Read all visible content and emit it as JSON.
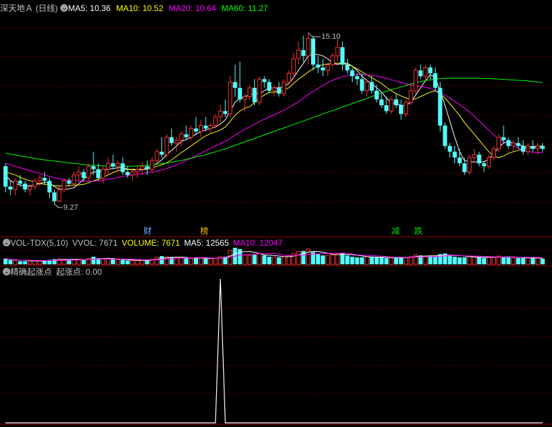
{
  "price_panel": {
    "title": "深天地Ａ (日线)",
    "ma_labels": [
      {
        "text": "MA5: 10.36",
        "color": "#ffffff"
      },
      {
        "text": "MA10: 10.52",
        "color": "#ffff00"
      },
      {
        "text": "MA20: 10.64",
        "color": "#ff00ff"
      },
      {
        "text": "MA60: 11.27",
        "color": "#00ff00"
      }
    ],
    "high_marker": "15.10",
    "low_marker": "9.27",
    "events": [
      {
        "text": "财",
        "color": "#6fa8ff"
      },
      {
        "text": "榜",
        "color": "#ffbf00"
      },
      {
        "text": "减",
        "color": "#00dd00"
      },
      {
        "text": "跌",
        "color": "#00dd00"
      }
    ]
  },
  "volume_panel": {
    "items": [
      {
        "text": "VOL-TDX(5,10)",
        "color": "#c0c0c0"
      },
      {
        "text": "VVOL: 7671",
        "color": "#c0c0c0"
      },
      {
        "text": "VOLUME: 7671",
        "color": "#ffff00"
      },
      {
        "text": "MA5: 12565",
        "color": "#ffffff"
      },
      {
        "text": "MA10: 12047",
        "color": "#ff00ff"
      }
    ]
  },
  "indicator_panel": {
    "title": "精确起涨点",
    "value_label": "起涨点: 0.00"
  },
  "colors": {
    "up": "#ff3232",
    "down": "#54ffff",
    "grid": "#9a0000",
    "ma5": "#ffffff",
    "ma10": "#ffff00",
    "ma20": "#ff00ff",
    "ma60": "#00ff00"
  },
  "chart_data": {
    "type": "candlestick",
    "price_range": [
      8.6,
      15.7
    ],
    "candles": [
      [
        10.5,
        10.6,
        9.6,
        9.8
      ],
      [
        9.8,
        10.0,
        9.5,
        9.7
      ],
      [
        9.7,
        10.1,
        9.5,
        10.0
      ],
      [
        10.0,
        10.2,
        9.8,
        9.9
      ],
      [
        9.9,
        10.0,
        9.6,
        9.7
      ],
      [
        9.7,
        9.9,
        9.5,
        9.8
      ],
      [
        9.8,
        10.1,
        9.7,
        10.0
      ],
      [
        10.0,
        10.2,
        9.8,
        10.1
      ],
      [
        10.1,
        10.3,
        9.9,
        10.0
      ],
      [
        10.0,
        10.1,
        9.4,
        9.6
      ],
      [
        9.6,
        9.7,
        9.2,
        9.3
      ],
      [
        9.3,
        9.8,
        9.27,
        9.7
      ],
      [
        9.7,
        10.1,
        9.6,
        10.0
      ],
      [
        10.0,
        10.1,
        9.8,
        9.9
      ],
      [
        9.9,
        10.3,
        9.8,
        10.2
      ],
      [
        10.2,
        10.5,
        10.0,
        10.3
      ],
      [
        10.3,
        10.4,
        10.0,
        10.1
      ],
      [
        10.1,
        10.6,
        10.0,
        10.5
      ],
      [
        10.5,
        11.0,
        10.2,
        10.4
      ],
      [
        10.4,
        10.6,
        10.0,
        10.1
      ],
      [
        10.1,
        10.5,
        9.9,
        10.4
      ],
      [
        10.4,
        10.8,
        10.2,
        10.6
      ],
      [
        10.6,
        10.9,
        10.4,
        10.5
      ],
      [
        10.5,
        10.7,
        10.3,
        10.6
      ],
      [
        10.6,
        10.8,
        10.2,
        10.3
      ],
      [
        10.3,
        10.5,
        10.1,
        10.2
      ],
      [
        10.2,
        10.4,
        10.0,
        10.3
      ],
      [
        10.3,
        10.5,
        10.1,
        10.4
      ],
      [
        10.4,
        10.6,
        10.2,
        10.5
      ],
      [
        10.5,
        10.7,
        10.2,
        10.4
      ],
      [
        10.4,
        10.8,
        10.3,
        10.7
      ],
      [
        10.7,
        11.1,
        10.6,
        11.0
      ],
      [
        11.0,
        11.5,
        10.8,
        10.9
      ],
      [
        10.9,
        11.6,
        10.8,
        11.5
      ],
      [
        11.5,
        11.8,
        11.2,
        11.3
      ],
      [
        11.3,
        11.5,
        11.0,
        11.4
      ],
      [
        11.4,
        11.7,
        11.2,
        11.6
      ],
      [
        11.6,
        11.9,
        11.4,
        11.5
      ],
      [
        11.5,
        11.9,
        11.4,
        11.8
      ],
      [
        11.8,
        12.2,
        11.6,
        11.7
      ],
      [
        11.7,
        12.1,
        11.5,
        11.9
      ],
      [
        11.9,
        12.2,
        11.7,
        11.8
      ],
      [
        11.8,
        12.0,
        11.6,
        11.9
      ],
      [
        11.9,
        12.3,
        11.8,
        12.2
      ],
      [
        12.2,
        12.6,
        12.0,
        12.4
      ],
      [
        12.4,
        12.8,
        12.2,
        12.3
      ],
      [
        12.3,
        13.6,
        12.2,
        13.4
      ],
      [
        13.4,
        14.0,
        12.9,
        13.2
      ],
      [
        13.2,
        14.1,
        12.7,
        12.8
      ],
      [
        12.8,
        13.0,
        12.4,
        12.9
      ],
      [
        12.9,
        13.3,
        12.8,
        13.2
      ],
      [
        13.2,
        13.5,
        12.6,
        12.7
      ],
      [
        12.7,
        13.6,
        12.6,
        13.5
      ],
      [
        13.5,
        13.6,
        13.2,
        13.4
      ],
      [
        13.4,
        13.5,
        13.0,
        13.1
      ],
      [
        13.1,
        13.3,
        12.9,
        13.2
      ],
      [
        13.2,
        13.4,
        12.9,
        13.0
      ],
      [
        13.0,
        13.5,
        12.9,
        13.4
      ],
      [
        13.4,
        13.8,
        13.3,
        13.7
      ],
      [
        13.7,
        14.4,
        13.5,
        14.2
      ],
      [
        14.2,
        14.8,
        14.0,
        14.5
      ],
      [
        14.5,
        15.0,
        14.1,
        14.3
      ],
      [
        14.3,
        15.1,
        14.0,
        14.9
      ],
      [
        14.9,
        15.0,
        13.8,
        14.0
      ],
      [
        14.0,
        14.3,
        13.7,
        13.9
      ],
      [
        13.9,
        14.2,
        13.6,
        13.8
      ],
      [
        13.8,
        14.0,
        13.6,
        14.0
      ],
      [
        14.0,
        14.4,
        13.9,
        14.3
      ],
      [
        14.3,
        14.9,
        14.1,
        14.6
      ],
      [
        14.6,
        14.8,
        13.8,
        14.0
      ],
      [
        14.0,
        14.2,
        13.7,
        13.8
      ],
      [
        13.8,
        13.9,
        13.4,
        13.6
      ],
      [
        13.6,
        13.7,
        13.3,
        13.5
      ],
      [
        13.5,
        13.7,
        13.0,
        13.1
      ],
      [
        13.1,
        13.5,
        12.9,
        13.4
      ],
      [
        13.4,
        13.6,
        13.0,
        13.1
      ],
      [
        13.1,
        13.3,
        12.7,
        12.8
      ],
      [
        12.8,
        13.0,
        12.5,
        12.6
      ],
      [
        12.6,
        12.9,
        12.3,
        12.4
      ],
      [
        12.4,
        12.9,
        12.3,
        12.8
      ],
      [
        12.8,
        13.0,
        12.5,
        12.6
      ],
      [
        12.6,
        12.8,
        12.1,
        12.3
      ],
      [
        12.3,
        12.8,
        12.2,
        12.7
      ],
      [
        12.7,
        13.3,
        12.6,
        13.1
      ],
      [
        13.1,
        13.9,
        13.0,
        13.8
      ],
      [
        13.8,
        14.0,
        13.5,
        13.6
      ],
      [
        13.6,
        14.0,
        13.4,
        13.9
      ],
      [
        13.9,
        14.0,
        13.5,
        13.7
      ],
      [
        13.7,
        13.9,
        13.1,
        13.2
      ],
      [
        13.2,
        13.4,
        11.7,
        11.9
      ],
      [
        11.9,
        12.0,
        11.1,
        11.2
      ],
      [
        11.2,
        11.3,
        10.8,
        11.0
      ],
      [
        11.0,
        11.2,
        10.6,
        10.8
      ],
      [
        10.8,
        11.1,
        10.5,
        10.6
      ],
      [
        10.6,
        10.8,
        10.2,
        10.3
      ],
      [
        10.3,
        10.9,
        10.2,
        10.8
      ],
      [
        10.8,
        11.1,
        10.6,
        10.9
      ],
      [
        10.9,
        11.0,
        10.5,
        10.6
      ],
      [
        10.6,
        10.7,
        10.3,
        10.5
      ],
      [
        10.5,
        10.9,
        10.4,
        10.8
      ],
      [
        10.8,
        11.2,
        10.7,
        11.1
      ],
      [
        11.1,
        11.6,
        11.0,
        11.5
      ],
      [
        11.5,
        11.9,
        11.3,
        11.4
      ],
      [
        11.4,
        11.5,
        11.1,
        11.2
      ],
      [
        11.2,
        11.4,
        11.0,
        11.3
      ],
      [
        11.3,
        11.5,
        11.1,
        11.2
      ],
      [
        11.2,
        11.4,
        10.9,
        11.0
      ],
      [
        11.0,
        11.3,
        10.9,
        11.2
      ],
      [
        11.2,
        11.4,
        11.0,
        11.1
      ],
      [
        11.1,
        11.3,
        10.9,
        11.2
      ],
      [
        11.2,
        11.3,
        11.0,
        11.1
      ]
    ],
    "ma_series": {
      "MA5": [
        10.2,
        10.0,
        9.9,
        9.85,
        9.82,
        9.82,
        9.86,
        9.9,
        9.95,
        9.92,
        9.8,
        9.72,
        9.7,
        9.72,
        9.76,
        9.9,
        10.05,
        10.2,
        10.3,
        10.3,
        10.35,
        10.4,
        10.42,
        10.45,
        10.45,
        10.4,
        10.38,
        10.36,
        10.38,
        10.4,
        10.5,
        10.6,
        10.72,
        10.9,
        11.05,
        11.2,
        11.35,
        11.42,
        11.5,
        11.6,
        11.7,
        11.75,
        11.8,
        11.85,
        11.95,
        12.1,
        12.4,
        12.7,
        12.85,
        12.9,
        12.95,
        13.0,
        13.0,
        13.1,
        13.2,
        13.2,
        13.2,
        13.25,
        13.35,
        13.55,
        13.8,
        14.05,
        14.3,
        14.35,
        14.35,
        14.3,
        14.2,
        14.05,
        14.0,
        14.05,
        14.05,
        13.95,
        13.8,
        13.6,
        13.45,
        13.35,
        13.2,
        13.05,
        12.85,
        12.7,
        12.65,
        12.6,
        12.6,
        12.7,
        12.95,
        13.2,
        13.45,
        13.65,
        13.55,
        13.1,
        12.6,
        12.05,
        11.5,
        11.0,
        10.7,
        10.65,
        10.65,
        10.65,
        10.65,
        10.75,
        10.95,
        11.15,
        11.3,
        11.35,
        11.3,
        11.25,
        11.2,
        11.15,
        11.15,
        11.15,
        11.15
      ],
      "MA10": [
        10.3,
        10.25,
        10.2,
        10.12,
        10.05,
        10.0,
        9.95,
        9.9,
        9.88,
        9.86,
        9.84,
        9.82,
        9.82,
        9.83,
        9.85,
        9.86,
        9.88,
        9.93,
        10.0,
        10.05,
        10.12,
        10.2,
        10.28,
        10.35,
        10.38,
        10.4,
        10.4,
        10.4,
        10.41,
        10.42,
        10.45,
        10.5,
        10.55,
        10.62,
        10.72,
        10.85,
        10.97,
        11.08,
        11.2,
        11.32,
        11.44,
        11.55,
        11.62,
        11.68,
        11.75,
        11.85,
        12.05,
        12.25,
        12.4,
        12.5,
        12.55,
        12.7,
        12.85,
        12.95,
        13.05,
        13.05,
        13.08,
        13.12,
        13.2,
        13.35,
        13.5,
        13.62,
        13.75,
        13.85,
        13.95,
        14.0,
        14.02,
        14.05,
        14.05,
        14.05,
        14.0,
        13.95,
        13.85,
        13.75,
        13.65,
        13.55,
        13.45,
        13.35,
        13.22,
        13.1,
        13.0,
        12.92,
        12.85,
        12.8,
        12.82,
        12.9,
        12.98,
        13.05,
        13.1,
        13.0,
        12.85,
        12.65,
        12.45,
        12.25,
        12.0,
        11.8,
        11.6,
        11.4,
        11.2,
        11.0,
        10.85,
        10.8,
        10.85,
        10.95,
        11.0,
        11.05,
        11.1,
        11.15,
        11.18,
        11.2,
        11.2
      ],
      "MA20": [
        10.6,
        10.55,
        10.5,
        10.45,
        10.4,
        10.35,
        10.3,
        10.25,
        10.2,
        10.15,
        10.1,
        10.07,
        10.04,
        10.02,
        10.0,
        9.99,
        9.98,
        9.98,
        9.99,
        10.0,
        10.02,
        10.05,
        10.08,
        10.12,
        10.15,
        10.18,
        10.2,
        10.22,
        10.25,
        10.28,
        10.3,
        10.33,
        10.37,
        10.42,
        10.48,
        10.55,
        10.62,
        10.7,
        10.78,
        10.86,
        10.95,
        11.04,
        11.12,
        11.2,
        11.28,
        11.36,
        11.46,
        11.57,
        11.67,
        11.77,
        11.86,
        11.95,
        12.04,
        12.12,
        12.2,
        12.27,
        12.35,
        12.43,
        12.52,
        12.62,
        12.72,
        12.85,
        12.97,
        13.08,
        13.18,
        13.28,
        13.38,
        13.46,
        13.53,
        13.58,
        13.62,
        13.65,
        13.66,
        13.66,
        13.65,
        13.63,
        13.6,
        13.57,
        13.53,
        13.48,
        13.43,
        13.38,
        13.34,
        13.3,
        13.27,
        13.25,
        13.22,
        13.18,
        13.12,
        13.04,
        12.95,
        12.85,
        12.74,
        12.62,
        12.5,
        12.37,
        12.22,
        12.06,
        11.9,
        11.74,
        11.58,
        11.45,
        11.35,
        11.27,
        11.2,
        11.12,
        11.05,
        11.0,
        10.98,
        10.97,
        10.97
      ],
      "MA60": [
        10.95,
        10.92,
        10.89,
        10.86,
        10.83,
        10.8,
        10.77,
        10.74,
        10.72,
        10.7,
        10.68,
        10.66,
        10.64,
        10.62,
        10.6,
        10.58,
        10.56,
        10.54,
        10.53,
        10.52,
        10.51,
        10.5,
        10.5,
        10.5,
        10.5,
        10.5,
        10.5,
        10.51,
        10.52,
        10.53,
        10.55,
        10.57,
        10.59,
        10.61,
        10.64,
        10.67,
        10.7,
        10.74,
        10.78,
        10.82,
        10.86,
        10.9,
        10.95,
        11.0,
        11.05,
        11.1,
        11.16,
        11.22,
        11.28,
        11.34,
        11.4,
        11.46,
        11.52,
        11.58,
        11.64,
        11.7,
        11.76,
        11.82,
        11.88,
        11.94,
        12.0,
        12.06,
        12.12,
        12.18,
        12.24,
        12.3,
        12.36,
        12.42,
        12.48,
        12.54,
        12.6,
        12.66,
        12.72,
        12.78,
        12.84,
        12.9,
        12.96,
        13.02,
        13.08,
        13.13,
        13.18,
        13.23,
        13.28,
        13.33,
        13.38,
        13.42,
        13.45,
        13.48,
        13.5,
        13.52,
        13.53,
        13.53,
        13.53,
        13.53,
        13.53,
        13.53,
        13.53,
        13.53,
        13.52,
        13.52,
        13.51,
        13.5,
        13.49,
        13.48,
        13.47,
        13.46,
        13.45,
        13.44,
        13.42,
        13.4,
        13.38
      ]
    },
    "volume": [
      9,
      7,
      6,
      5,
      5,
      5,
      6,
      6,
      5,
      7,
      8,
      9,
      8,
      7,
      7,
      8,
      7,
      9,
      12,
      9,
      8,
      9,
      8,
      7,
      7,
      6,
      6,
      6,
      7,
      7,
      8,
      11,
      13,
      12,
      11,
      10,
      11,
      10,
      9,
      10,
      10,
      9,
      9,
      10,
      12,
      12,
      22,
      26,
      24,
      15,
      14,
      15,
      17,
      14,
      12,
      11,
      11,
      12,
      14,
      17,
      20,
      21,
      24,
      19,
      16,
      14,
      14,
      15,
      17,
      18,
      14,
      12,
      11,
      11,
      12,
      12,
      11,
      11,
      10,
      10,
      11,
      11,
      11,
      12,
      15,
      14,
      13,
      13,
      12,
      16,
      17,
      14,
      12,
      11,
      11,
      12,
      12,
      11,
      10,
      11,
      12,
      13,
      12,
      11,
      10,
      10,
      10,
      10,
      10,
      10,
      9
    ],
    "indicator": {
      "spike_index": 44,
      "spike_value": 1.0
    }
  }
}
